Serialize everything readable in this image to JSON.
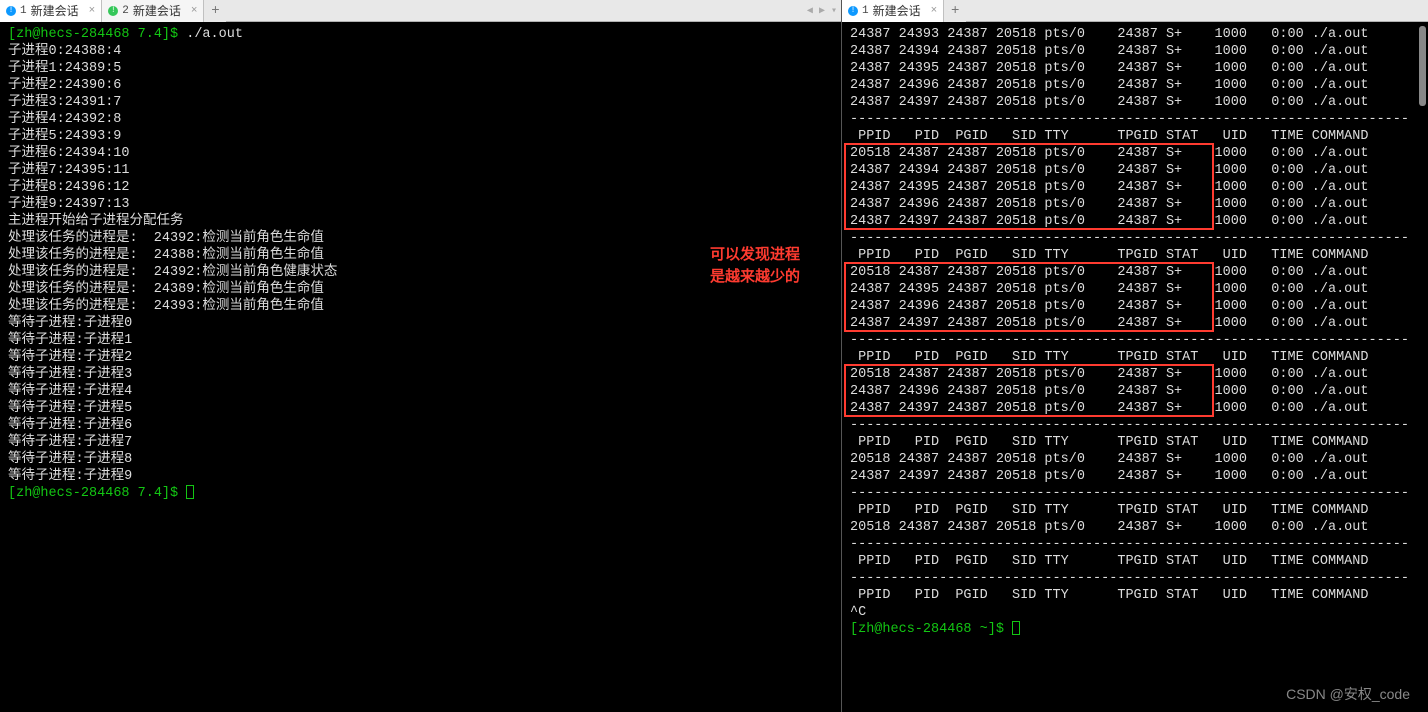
{
  "left_tabs": [
    {
      "color": "blue",
      "num": "1",
      "label": "新建会话",
      "active": true
    },
    {
      "color": "green",
      "num": "2",
      "label": "新建会话",
      "active": false
    }
  ],
  "right_tabs": [
    {
      "color": "blue",
      "num": "1",
      "label": "新建会话",
      "active": true
    }
  ],
  "plus": "+",
  "prompt_left": {
    "host": "[zh@hecs-284468 7.4]$ ",
    "cmd": "./a.out"
  },
  "prompt_left_end": {
    "host": "[zh@hecs-284468 7.4]$ "
  },
  "left_lines": [
    "子进程0:24388:4",
    "子进程1:24389:5",
    "子进程2:24390:6",
    "子进程3:24391:7",
    "子进程4:24392:8",
    "子进程5:24393:9",
    "子进程6:24394:10",
    "子进程7:24395:11",
    "子进程8:24396:12",
    "子进程9:24397:13",
    "主进程开始给子进程分配任务",
    "处理该任务的进程是:  24392:检测当前角色生命值",
    "处理该任务的进程是:  24388:检测当前角色生命值",
    "处理该任务的进程是:  24392:检测当前角色健康状态",
    "处理该任务的进程是:  24389:检测当前角色生命值",
    "处理该任务的进程是:  24393:检测当前角色生命值",
    "等待子进程:子进程0",
    "等待子进程:子进程1",
    "等待子进程:子进程2",
    "等待子进程:子进程3",
    "等待子进程:子进程4",
    "等待子进程:子进程5",
    "等待子进程:子进程6",
    "等待子进程:子进程7",
    "等待子进程:子进程8",
    "等待子进程:子进程9"
  ],
  "annotation": {
    "l1": "可以发现进程",
    "l2": "是越来越少的"
  },
  "header": " PPID   PID  PGID   SID TTY      TPGID STAT   UID   TIME COMMAND",
  "dash": "---------------------------------------------------------------------",
  "right_blocks": [
    {
      "redbox": false,
      "header": false,
      "rows": [
        "24387 24393 24387 20518 pts/0    24387 S+    1000   0:00 ./a.out",
        "24387 24394 24387 20518 pts/0    24387 S+    1000   0:00 ./a.out",
        "24387 24395 24387 20518 pts/0    24387 S+    1000   0:00 ./a.out",
        "24387 24396 24387 20518 pts/0    24387 S+    1000   0:00 ./a.out",
        "24387 24397 24387 20518 pts/0    24387 S+    1000   0:00 ./a.out"
      ]
    },
    {
      "redbox": true,
      "header": true,
      "rows": [
        "20518 24387 24387 20518 pts/0    24387 S+    1000   0:00 ./a.out",
        "24387 24394 24387 20518 pts/0    24387 S+    1000   0:00 ./a.out",
        "24387 24395 24387 20518 pts/0    24387 S+    1000   0:00 ./a.out",
        "24387 24396 24387 20518 pts/0    24387 S+    1000   0:00 ./a.out",
        "24387 24397 24387 20518 pts/0    24387 S+    1000   0:00 ./a.out"
      ]
    },
    {
      "redbox": true,
      "header": true,
      "rows": [
        "20518 24387 24387 20518 pts/0    24387 S+    1000   0:00 ./a.out",
        "24387 24395 24387 20518 pts/0    24387 S+    1000   0:00 ./a.out",
        "24387 24396 24387 20518 pts/0    24387 S+    1000   0:00 ./a.out",
        "24387 24397 24387 20518 pts/0    24387 S+    1000   0:00 ./a.out"
      ]
    },
    {
      "redbox": true,
      "header": true,
      "rows": [
        "20518 24387 24387 20518 pts/0    24387 S+    1000   0:00 ./a.out",
        "24387 24396 24387 20518 pts/0    24387 S+    1000   0:00 ./a.out",
        "24387 24397 24387 20518 pts/0    24387 S+    1000   0:00 ./a.out"
      ]
    },
    {
      "redbox": false,
      "header": true,
      "rows": [
        "20518 24387 24387 20518 pts/0    24387 S+    1000   0:00 ./a.out",
        "24387 24397 24387 20518 pts/0    24387 S+    1000   0:00 ./a.out"
      ]
    },
    {
      "redbox": false,
      "header": true,
      "rows": [
        "20518 24387 24387 20518 pts/0    24387 S+    1000   0:00 ./a.out"
      ]
    },
    {
      "redbox": false,
      "header": true,
      "rows": []
    },
    {
      "redbox": false,
      "header": true,
      "rows": []
    }
  ],
  "right_tail": {
    "ctrlc": "^C",
    "prompt": "[zh@hecs-284468 ~]$ "
  },
  "watermark": "CSDN @安权_code"
}
